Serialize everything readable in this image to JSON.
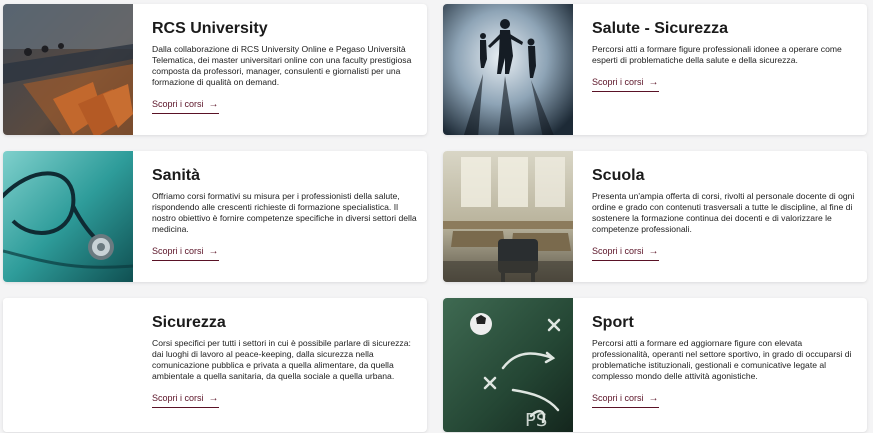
{
  "cards": [
    {
      "title": "RCS University",
      "description": "Dalla collaborazione di RCS University Online e Pegaso Università Telematica, dei master universitari online con una faculty prestigiosa composta da professori, manager, consulenti e giornalisti per una formazione di qualità on demand.",
      "cta": "Scopri i corsi",
      "arrow": "→"
    },
    {
      "title": "Salute - Sicurezza",
      "description": "Percorsi atti a formare figure professionali idonee a operare come esperti di problematiche della salute e della sicurezza.",
      "cta": "Scopri i corsi",
      "arrow": "→"
    },
    {
      "title": "Sanità",
      "description": "Offriamo corsi formativi su misura per i professionisti della salute, rispondendo alle crescenti richieste di formazione specialistica. Il nostro obiettivo è fornire competenze specifiche in diversi settori della medicina.",
      "cta": "Scopri i corsi",
      "arrow": "→"
    },
    {
      "title": "Scuola",
      "description": "Presenta un'ampia offerta di corsi, rivolti al personale docente di ogni ordine e grado con contenuti trasversali a tutte le discipline, al fine di sostenere la formazione continua dei docenti e di valorizzare le competenze professionali.",
      "cta": "Scopri i corsi",
      "arrow": "→"
    },
    {
      "title": "Sicurezza",
      "description": "Corsi specifici per tutti i settori in cui è possibile parlare di sicurezza: dai luoghi di lavoro al peace-keeping, dalla sicurezza nella comunicazione pubblica e privata a quella alimentare, da quella ambientale a quella sanitaria, da quella sociale a quella urbana.",
      "cta": "Scopri i corsi",
      "arrow": "→"
    },
    {
      "title": "Sport",
      "description": "Percorsi atti a formare ed aggiornare figure con elevata professionalità, operanti nel settore sportivo, in grado di occuparsi di problematiche istituzionali, gestionali e comunicative legate al complesso mondo delle attività agonistiche.",
      "cta": "Scopri i corsi",
      "arrow": "→"
    }
  ],
  "colors": {
    "accent": "#5a1226",
    "page_background": "#f4f4f5",
    "card_background": "#ffffff"
  }
}
